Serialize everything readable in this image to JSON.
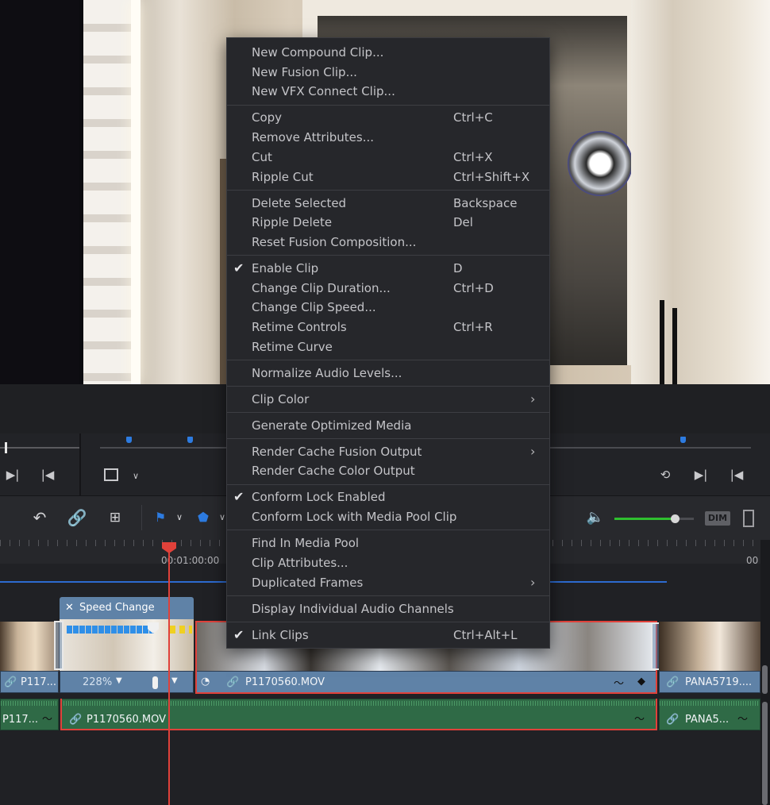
{
  "timeline": {
    "timecode": "00:01:00:00",
    "timecode_right": "00",
    "speed_change_label": "Speed Change",
    "speed_percent": "228%",
    "clips": {
      "video_left_name": "P117...",
      "video_main_name": "P1170560.MOV",
      "video_right_name": "PANA5719....",
      "audio_left_name": "P117...",
      "audio_main_name": "P1170560.MOV",
      "audio_right_name": "PANA5..."
    },
    "colors": {
      "playhead": "#e0413a",
      "video_clip": "#5f82a7",
      "audio_clip": "#2f6a46",
      "selection": "#e0413a"
    }
  },
  "toolbar": {
    "dim_label": "DIM",
    "volume_level": 0.76,
    "icons": [
      "snap-icon",
      "link-icon",
      "position-lock-icon",
      "flag-icon",
      "marker-icon",
      "speaker-icon",
      "split-view-icon"
    ]
  },
  "transport": {
    "icons": [
      "jump-next-icon",
      "jump-prev-icon",
      "crop-icon",
      "chevron-down-icon",
      "loop-icon",
      "jump-next-icon",
      "jump-prev-icon"
    ]
  },
  "menu": {
    "groups": [
      [
        {
          "label": "New Compound Clip...",
          "shortcut": "",
          "checked": false,
          "submenu": false
        },
        {
          "label": "New Fusion Clip...",
          "shortcut": "",
          "checked": false,
          "submenu": false
        },
        {
          "label": "New VFX Connect Clip...",
          "shortcut": "",
          "checked": false,
          "submenu": false
        }
      ],
      [
        {
          "label": "Copy",
          "shortcut": "Ctrl+C",
          "checked": false,
          "submenu": false
        },
        {
          "label": "Remove Attributes...",
          "shortcut": "",
          "checked": false,
          "submenu": false
        },
        {
          "label": "Cut",
          "shortcut": "Ctrl+X",
          "checked": false,
          "submenu": false
        },
        {
          "label": "Ripple Cut",
          "shortcut": "Ctrl+Shift+X",
          "checked": false,
          "submenu": false
        }
      ],
      [
        {
          "label": "Delete Selected",
          "shortcut": "Backspace",
          "checked": false,
          "submenu": false
        },
        {
          "label": "Ripple Delete",
          "shortcut": "Del",
          "checked": false,
          "submenu": false
        },
        {
          "label": "Reset Fusion Composition...",
          "shortcut": "",
          "checked": false,
          "submenu": false
        }
      ],
      [
        {
          "label": "Enable Clip",
          "shortcut": "D",
          "checked": true,
          "submenu": false
        },
        {
          "label": "Change Clip Duration...",
          "shortcut": "Ctrl+D",
          "checked": false,
          "submenu": false
        },
        {
          "label": "Change Clip Speed...",
          "shortcut": "",
          "checked": false,
          "submenu": false
        },
        {
          "label": "Retime Controls",
          "shortcut": "Ctrl+R",
          "checked": false,
          "submenu": false
        },
        {
          "label": "Retime Curve",
          "shortcut": "",
          "checked": false,
          "submenu": false
        }
      ],
      [
        {
          "label": "Normalize Audio Levels...",
          "shortcut": "",
          "checked": false,
          "submenu": false
        }
      ],
      [
        {
          "label": "Clip Color",
          "shortcut": "",
          "checked": false,
          "submenu": true
        }
      ],
      [
        {
          "label": "Generate Optimized Media",
          "shortcut": "",
          "checked": false,
          "submenu": false
        }
      ],
      [
        {
          "label": "Render Cache Fusion Output",
          "shortcut": "",
          "checked": false,
          "submenu": true
        },
        {
          "label": "Render Cache Color Output",
          "shortcut": "",
          "checked": false,
          "submenu": false
        }
      ],
      [
        {
          "label": "Conform Lock Enabled",
          "shortcut": "",
          "checked": true,
          "submenu": false
        },
        {
          "label": "Conform Lock with Media Pool Clip",
          "shortcut": "",
          "checked": false,
          "submenu": false
        }
      ],
      [
        {
          "label": "Find In Media Pool",
          "shortcut": "",
          "checked": false,
          "submenu": false
        },
        {
          "label": "Clip Attributes...",
          "shortcut": "",
          "checked": false,
          "submenu": false
        },
        {
          "label": "Duplicated Frames",
          "shortcut": "",
          "checked": false,
          "submenu": true
        }
      ],
      [
        {
          "label": "Display Individual Audio Channels",
          "shortcut": "",
          "checked": false,
          "submenu": false
        }
      ],
      [
        {
          "label": "Link Clips",
          "shortcut": "Ctrl+Alt+L",
          "checked": true,
          "submenu": false
        }
      ]
    ]
  }
}
